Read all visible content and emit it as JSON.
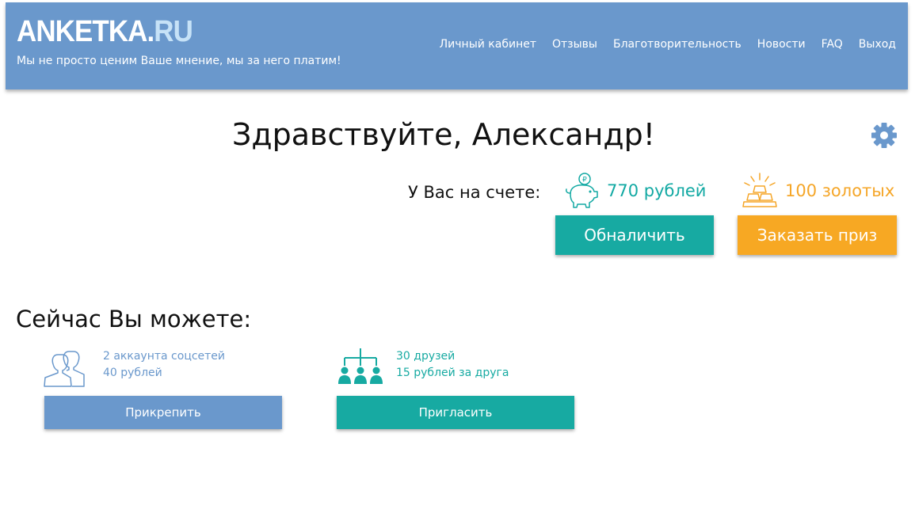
{
  "header": {
    "logo_main": "ANKETKA.",
    "logo_tld": "RU",
    "tagline": "Мы не просто ценим Ваше мнение, мы за него платим!",
    "nav": [
      {
        "label": "Личный кабинет"
      },
      {
        "label": "Отзывы"
      },
      {
        "label": "Благотворительность"
      },
      {
        "label": "Новости"
      },
      {
        "label": "FAQ"
      },
      {
        "label": "Выход"
      }
    ]
  },
  "greeting": "Здравствуйте, Александр!",
  "balance": {
    "label": "У Вас на счете:",
    "rubles": "770 рублей",
    "gold": "100 золотых",
    "coin_symbol": "₽",
    "cash_button": "Обналичить",
    "prize_button": "Заказать приз"
  },
  "opportunities": {
    "title": "Сейчас Вы можете:",
    "items": [
      {
        "line1": "2 аккаунта соцсетей",
        "line2": "40 рублей",
        "button": "Прикрепить"
      },
      {
        "line1": "30 друзей",
        "line2": "15 рублей за друга",
        "button": "Пригласить"
      }
    ]
  },
  "colors": {
    "header_bg": "#6a98cc",
    "teal": "#17aaa2",
    "orange": "#f7a823",
    "blue": "#6a98cc"
  },
  "icons": {
    "settings": "gear-icon",
    "rubles": "piggy-bank-icon",
    "gold": "gold-bars-icon",
    "social": "users-icon",
    "friends": "referral-tree-icon"
  }
}
